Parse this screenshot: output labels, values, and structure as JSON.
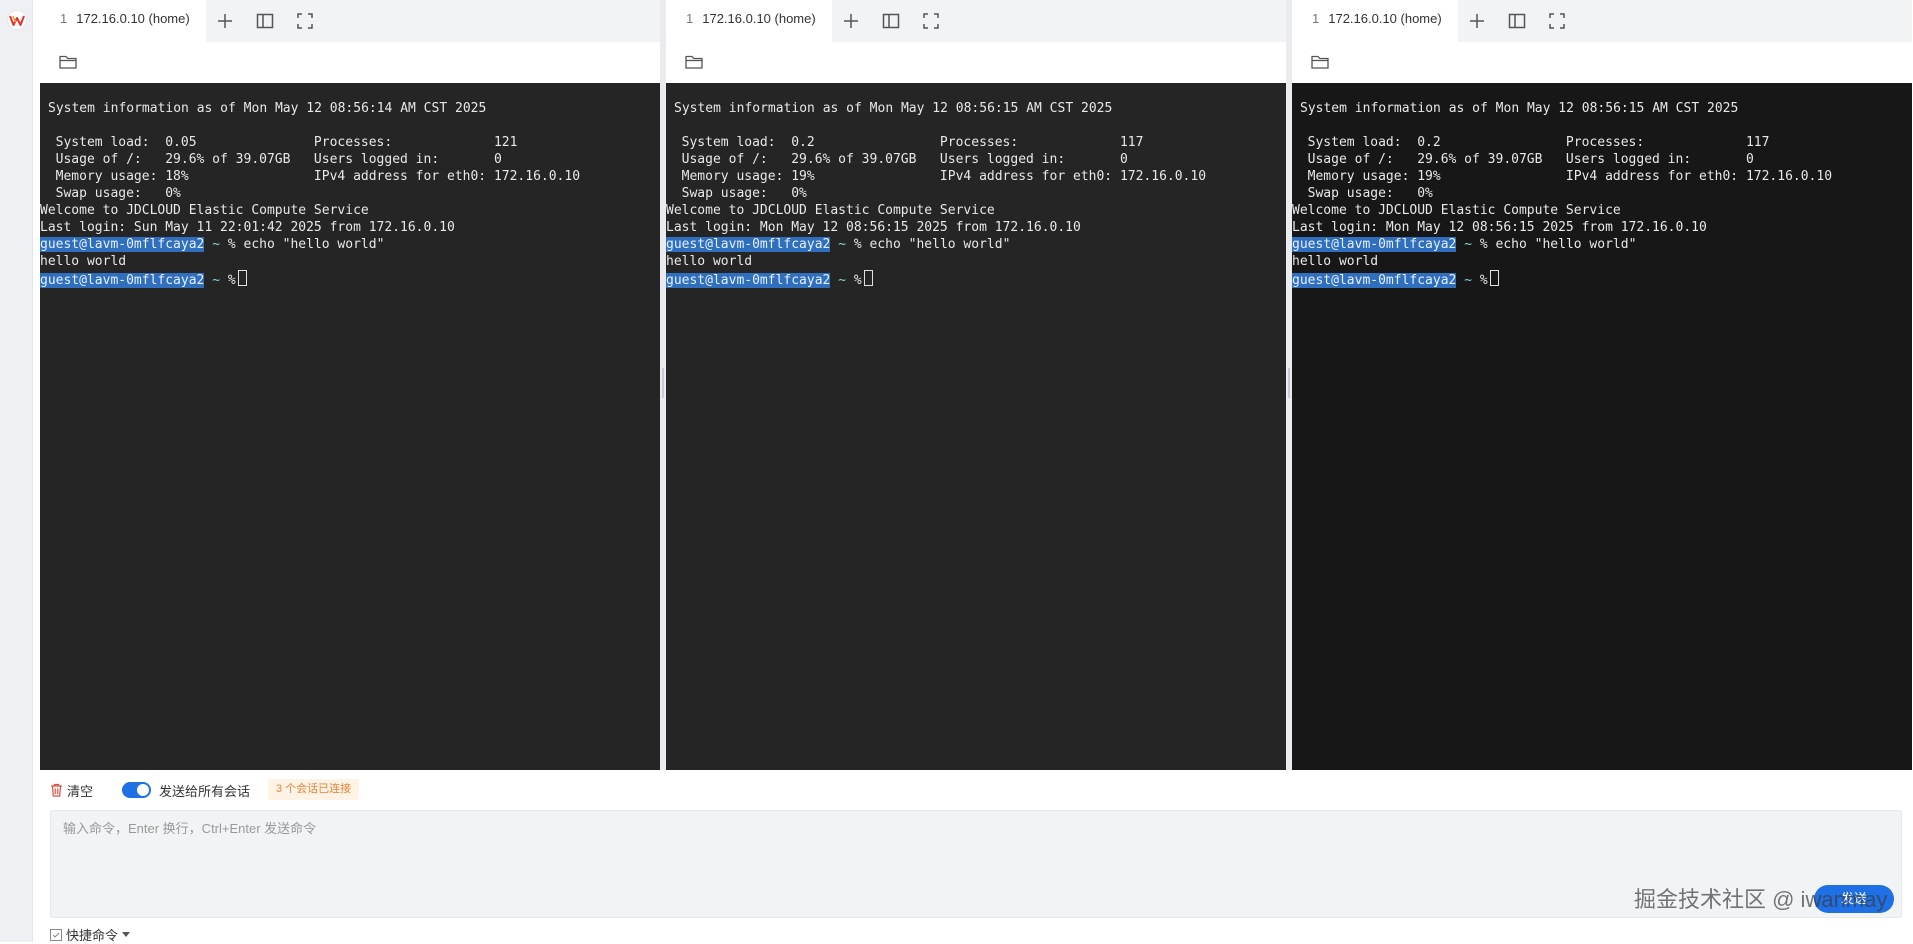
{
  "panes": [
    {
      "tab_index": "1",
      "tab_title": "172.16.0.10 (home)",
      "terminal": {
        "header": "System information as of Mon May 12 08:56:14 AM CST 2025",
        "stats": [
          "  System load:  0.05               Processes:             121",
          "  Usage of /:   29.6% of 39.07GB   Users logged in:       0",
          "  Memory usage: 18%                IPv4 address for eth0: 172.16.0.10",
          "  Swap usage:   0%"
        ],
        "welcome": "Welcome to JDCLOUD Elastic Compute Service",
        "last_login": "Last login: Sun May 11 22:01:42 2025 from 172.16.0.10",
        "prompt_user": "guest@lavm-0mflfcaya2",
        "prompt_sep": " ~ ",
        "prompt_symbol": "%",
        "command": " echo \"hello world\"",
        "output": "hello world"
      }
    },
    {
      "tab_index": "1",
      "tab_title": "172.16.0.10 (home)",
      "terminal": {
        "header": "System information as of Mon May 12 08:56:15 AM CST 2025",
        "stats": [
          "  System load:  0.2                Processes:             117",
          "  Usage of /:   29.6% of 39.07GB   Users logged in:       0",
          "  Memory usage: 19%                IPv4 address for eth0: 172.16.0.10",
          "  Swap usage:   0%"
        ],
        "welcome": "Welcome to JDCLOUD Elastic Compute Service",
        "last_login": "Last login: Mon May 12 08:56:15 2025 from 172.16.0.10",
        "prompt_user": "guest@lavm-0mflfcaya2",
        "prompt_sep": " ~ ",
        "prompt_symbol": "%",
        "command": " echo \"hello world\"",
        "output": "hello world"
      }
    },
    {
      "tab_index": "1",
      "tab_title": "172.16.0.10 (home)",
      "terminal": {
        "header": "System information as of Mon May 12 08:56:15 AM CST 2025",
        "stats": [
          "  System load:  0.2                Processes:             117",
          "  Usage of /:   29.6% of 39.07GB   Users logged in:       0",
          "  Memory usage: 19%                IPv4 address for eth0: 172.16.0.10",
          "  Swap usage:   0%"
        ],
        "welcome": "Welcome to JDCLOUD Elastic Compute Service",
        "last_login": "Last login: Mon May 12 08:56:15 2025 from 172.16.0.10",
        "prompt_user": "guest@lavm-0mflfcaya2",
        "prompt_sep": " ~ ",
        "prompt_symbol": "%",
        "command": " echo \"hello world\"",
        "output": "hello world"
      }
    }
  ],
  "bottom": {
    "clear_label": "清空",
    "broadcast_toggle_on": true,
    "broadcast_label": "发送给所有会话",
    "status_badge": "3 个会话已连接",
    "command_placeholder": "输入命令，Enter 换行，Ctrl+Enter 发送命令",
    "send_label": "发送",
    "quick_commands_label": "快捷命令",
    "watermark": "掘金技术社区 @ iwanmay"
  },
  "colors": {
    "accent": "#1f6fe5",
    "terminal_bg": "#252526",
    "terminal_bg_dark": "#171717",
    "prompt_highlight": "#2f6fbd",
    "status_badge_text": "#e8833a",
    "status_badge_bg": "#fff3e6"
  },
  "icons": [
    "app-logo-icon",
    "plus-icon",
    "split-pane-icon",
    "fullscreen-icon",
    "folder-icon",
    "trash-icon",
    "checkbox-icon",
    "caret-down-icon"
  ]
}
